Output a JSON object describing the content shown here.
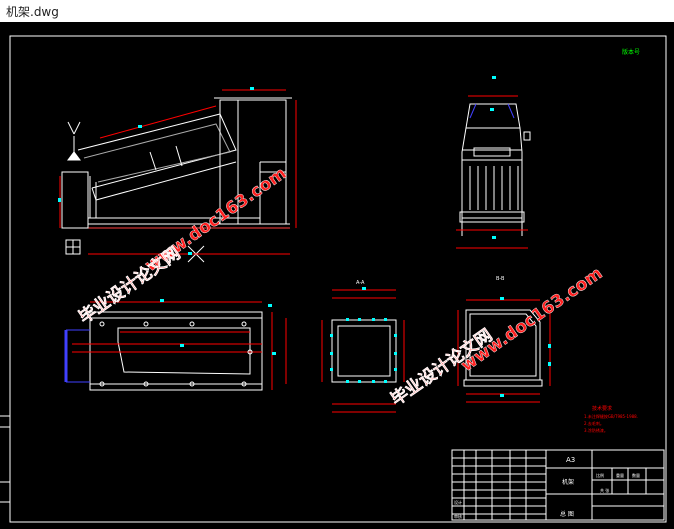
{
  "window": {
    "title": "机架.dwg"
  },
  "drawing": {
    "corner_mark": "版本号",
    "watermarks": [
      {
        "site": "www.doc163.com",
        "label": "毕业设计论文网"
      },
      {
        "site": "www.doc163.com",
        "label": "毕业设计论文网"
      }
    ],
    "view_labels": {
      "section_a": "A-A",
      "section_b": "B-B"
    },
    "tech_requirements": {
      "heading": "技术要求",
      "lines": [
        "1.未注焊缝按GB/T985-1988.",
        "2.去毛刺。",
        "3.涂防锈漆。"
      ]
    },
    "title_block": {
      "sheet_size": "A3",
      "part_name": "机架",
      "label_scale": "比例",
      "label_weight": "重量",
      "label_qty": "数量",
      "label_design": "设计",
      "label_check": "审核",
      "label_sheet": "共 张",
      "bottom": "总 图"
    },
    "colors": {
      "background": "#000000",
      "outline": "#ffffff",
      "dimension": "#ff0000",
      "marker": "#00ffff",
      "watermark_site": "#ff2020",
      "watermark_label": "#ff2020",
      "hatch": "#4040ff",
      "note": "#ff0000",
      "green": "#00ff00"
    }
  }
}
